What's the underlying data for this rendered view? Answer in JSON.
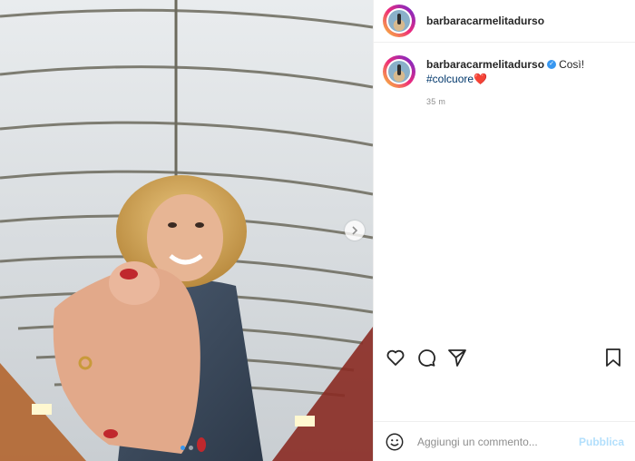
{
  "post": {
    "username": "barbaracarmelitadurso",
    "caption": {
      "username": "barbaracarmelitadurso",
      "text": "Così!",
      "hashtag": "#colcuore",
      "emoji": "❤️"
    },
    "time": "35 m",
    "carousel": {
      "total": 2,
      "active": 1
    }
  },
  "add_comment": {
    "placeholder": "Aggiungi un commento...",
    "publish_label": "Pubblica"
  },
  "colors": {
    "accent": "#3897f0",
    "publish_disabled": "#b2dffc",
    "muted": "#8e8e8e"
  }
}
